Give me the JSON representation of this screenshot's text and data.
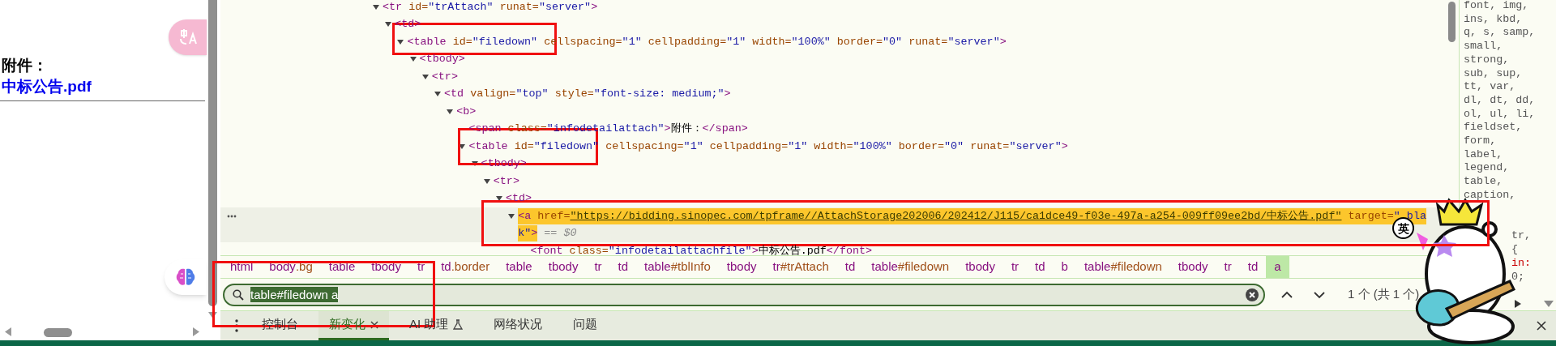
{
  "page": {
    "label": "附件：",
    "link": "中标公告.pdf"
  },
  "elements_tree": [
    {
      "expanded": true,
      "selected": false,
      "parts": [
        {
          "kind": "tag",
          "text": "<tr"
        },
        {
          "kind": "attr",
          "text": " id="
        },
        {
          "kind": "value",
          "text": "\"trAttach\""
        },
        {
          "kind": "attr",
          "text": " runat="
        },
        {
          "kind": "value",
          "text": "\"server\""
        },
        {
          "kind": "tag",
          "text": ">"
        }
      ],
      "children": [
        {
          "expanded": true,
          "selected": false,
          "parts": [
            {
              "kind": "tag",
              "text": "<td>"
            }
          ],
          "children": [
            {
              "expanded": true,
              "selected": false,
              "parts": [
                {
                  "kind": "tag",
                  "text": "<table"
                },
                {
                  "kind": "attr",
                  "text": " id="
                },
                {
                  "kind": "value",
                  "text": "\"filedown\""
                },
                {
                  "kind": "attr",
                  "text": " cellspacing="
                },
                {
                  "kind": "value",
                  "text": "\"1\""
                },
                {
                  "kind": "attr",
                  "text": " cellpadding="
                },
                {
                  "kind": "value",
                  "text": "\"1\""
                },
                {
                  "kind": "attr",
                  "text": " width="
                },
                {
                  "kind": "value",
                  "text": "\"100%\""
                },
                {
                  "kind": "attr",
                  "text": " border="
                },
                {
                  "kind": "value",
                  "text": "\"0\""
                },
                {
                  "kind": "attr",
                  "text": " runat="
                },
                {
                  "kind": "value",
                  "text": "\"server\""
                },
                {
                  "kind": "tag",
                  "text": ">"
                }
              ],
              "children": [
                {
                  "expanded": true,
                  "selected": false,
                  "parts": [
                    {
                      "kind": "tag",
                      "text": "<tbody>"
                    }
                  ],
                  "children": [
                    {
                      "expanded": true,
                      "selected": false,
                      "parts": [
                        {
                          "kind": "tag",
                          "text": "<tr>"
                        }
                      ],
                      "children": [
                        {
                          "expanded": true,
                          "selected": false,
                          "parts": [
                            {
                              "kind": "tag",
                              "text": "<td"
                            },
                            {
                              "kind": "attr",
                              "text": " valign="
                            },
                            {
                              "kind": "value",
                              "text": "\"top\""
                            },
                            {
                              "kind": "attr",
                              "text": " style="
                            },
                            {
                              "kind": "value",
                              "text": "\"font-size: medium;\""
                            },
                            {
                              "kind": "tag",
                              "text": ">"
                            }
                          ],
                          "children": [
                            {
                              "expanded": true,
                              "selected": false,
                              "parts": [
                                {
                                  "kind": "tag",
                                  "text": "<b>"
                                }
                              ],
                              "children": [
                                {
                                  "selected": false,
                                  "parts": [
                                    {
                                      "kind": "tag",
                                      "text": "<span"
                                    },
                                    {
                                      "kind": "attr",
                                      "text": " class="
                                    },
                                    {
                                      "kind": "value",
                                      "text": "\"infodetailattach\""
                                    },
                                    {
                                      "kind": "tag",
                                      "text": ">"
                                    },
                                    {
                                      "kind": "text",
                                      "text": "附件："
                                    },
                                    {
                                      "kind": "tag",
                                      "text": "</span>"
                                    }
                                  ]
                                },
                                {
                                  "expanded": true,
                                  "selected": false,
                                  "parts": [
                                    {
                                      "kind": "tag",
                                      "text": "<table"
                                    },
                                    {
                                      "kind": "attr",
                                      "text": " id="
                                    },
                                    {
                                      "kind": "value",
                                      "text": "\"filedown\""
                                    },
                                    {
                                      "kind": "attr",
                                      "text": " cellspacing="
                                    },
                                    {
                                      "kind": "value",
                                      "text": "\"1\""
                                    },
                                    {
                                      "kind": "attr",
                                      "text": " cellpadding="
                                    },
                                    {
                                      "kind": "value",
                                      "text": "\"1\""
                                    },
                                    {
                                      "kind": "attr",
                                      "text": " width="
                                    },
                                    {
                                      "kind": "value",
                                      "text": "\"100%\""
                                    },
                                    {
                                      "kind": "attr",
                                      "text": " border="
                                    },
                                    {
                                      "kind": "value",
                                      "text": "\"0\""
                                    },
                                    {
                                      "kind": "attr",
                                      "text": " runat="
                                    },
                                    {
                                      "kind": "value",
                                      "text": "\"server\""
                                    },
                                    {
                                      "kind": "tag",
                                      "text": ">"
                                    }
                                  ],
                                  "children": [
                                    {
                                      "expanded": true,
                                      "selected": false,
                                      "parts": [
                                        {
                                          "kind": "tag",
                                          "text": "<tbody>"
                                        }
                                      ],
                                      "children": [
                                        {
                                          "expanded": true,
                                          "selected": false,
                                          "parts": [
                                            {
                                              "kind": "tag",
                                              "text": "<tr>"
                                            }
                                          ],
                                          "children": [
                                            {
                                              "expanded": true,
                                              "selected": false,
                                              "parts": [
                                                {
                                                  "kind": "tag",
                                                  "text": "<td>"
                                                }
                                              ],
                                              "children": [
                                                {
                                                  "expanded": true,
                                                  "selected": true,
                                                  "search_match": true,
                                                  "parts": [
                                                    {
                                                      "kind": "tag",
                                                      "text": "<a"
                                                    },
                                                    {
                                                      "kind": "attr",
                                                      "text": " href="
                                                    },
                                                    {
                                                      "kind": "link",
                                                      "text": "\"https://bidding.sinopec.com/tpframe//AttachStorage202006/202412/J115/ca1dce49-f03e-497a-a254-009ff09ee2bd/中标公告.pdf\""
                                                    },
                                                    {
                                                      "kind": "attr",
                                                      "text": " target="
                                                    },
                                                    {
                                                      "kind": "value",
                                                      "text": "\"_bla"
                                                    }
                                                  ],
                                                  "wrap_parts": [
                                                    {
                                                      "kind": "value",
                                                      "text": "k\""
                                                    },
                                                    {
                                                      "kind": "tag",
                                                      "text": ">"
                                                    }
                                                  ],
                                                  "console_ref": "== $0",
                                                  "children": [
                                                    {
                                                      "selected": false,
                                                      "parts": [
                                                        {
                                                          "kind": "tag",
                                                          "text": "<font"
                                                        },
                                                        {
                                                          "kind": "attr",
                                                          "text": " class="
                                                        },
                                                        {
                                                          "kind": "value",
                                                          "text": "\"infodetailattachfile\""
                                                        },
                                                        {
                                                          "kind": "tag",
                                                          "text": ">"
                                                        },
                                                        {
                                                          "kind": "text",
                                                          "text": "中标公告.pdf"
                                                        },
                                                        {
                                                          "kind": "tag",
                                                          "text": "</font>"
                                                        }
                                                      ]
                                                    }
                                                  ]
                                                }
                                              ]
                                            }
                                          ]
                                        }
                                      ]
                                    }
                                  ]
                                }
                              ]
                            }
                          ]
                        }
                      ]
                    }
                  ]
                }
              ]
            }
          ]
        }
      ]
    }
  ],
  "breadcrumbs": [
    {
      "tag": "html",
      "selected": false
    },
    {
      "tag": "body",
      "suffix": ".bg",
      "selected": false
    },
    {
      "tag": "table",
      "selected": false
    },
    {
      "tag": "tbody",
      "selected": false
    },
    {
      "tag": "tr",
      "selected": false
    },
    {
      "tag": "td",
      "suffix": ".border",
      "selected": false
    },
    {
      "tag": "table",
      "selected": false
    },
    {
      "tag": "tbody",
      "selected": false
    },
    {
      "tag": "tr",
      "selected": false
    },
    {
      "tag": "td",
      "selected": false
    },
    {
      "tag": "table",
      "suffix": "#tblInfo",
      "selected": false
    },
    {
      "tag": "tbody",
      "selected": false
    },
    {
      "tag": "tr",
      "suffix": "#trAttach",
      "selected": false
    },
    {
      "tag": "td",
      "selected": false
    },
    {
      "tag": "table",
      "suffix": "#filedown",
      "selected": false
    },
    {
      "tag": "tbody",
      "selected": false
    },
    {
      "tag": "tr",
      "selected": false
    },
    {
      "tag": "td",
      "selected": false
    },
    {
      "tag": "b",
      "selected": false
    },
    {
      "tag": "table",
      "suffix": "#filedown",
      "selected": false
    },
    {
      "tag": "tbody",
      "selected": false
    },
    {
      "tag": "tr",
      "selected": false
    },
    {
      "tag": "td",
      "selected": false
    },
    {
      "tag": "a",
      "selected": true
    }
  ],
  "search": {
    "value": "table#filedown a",
    "match_count": "1 个 (共 1 个)"
  },
  "drawer_tabs": [
    {
      "label": "控制台",
      "selected": false,
      "closable": false,
      "beta": false
    },
    {
      "label": "新变化",
      "selected": true,
      "closable": true,
      "beta": false
    },
    {
      "label": "AI 助理",
      "selected": false,
      "closable": false,
      "beta": true
    },
    {
      "label": "网络状况",
      "selected": false,
      "closable": false,
      "beta": false
    },
    {
      "label": "问题",
      "selected": false,
      "closable": false,
      "beta": false
    }
  ],
  "styles": [
    "font, img,",
    "ins, kbd,",
    "q, s, samp,",
    "small,",
    "strong,",
    "sub, sup,",
    "tt, var,",
    "dl, dt, dd,",
    "ol, ul, li,",
    "fieldset,",
    "form,",
    "label,",
    "legend,",
    "table,",
    "caption,"
  ],
  "style_fragments": [
    {
      "text": "tr,",
      "kind": "selector"
    },
    {
      "text": "{",
      "kind": "selector"
    },
    {
      "text": "in:",
      "kind": "property"
    },
    {
      "text": "0;",
      "kind": "value"
    }
  ],
  "ime_indicator": "英"
}
